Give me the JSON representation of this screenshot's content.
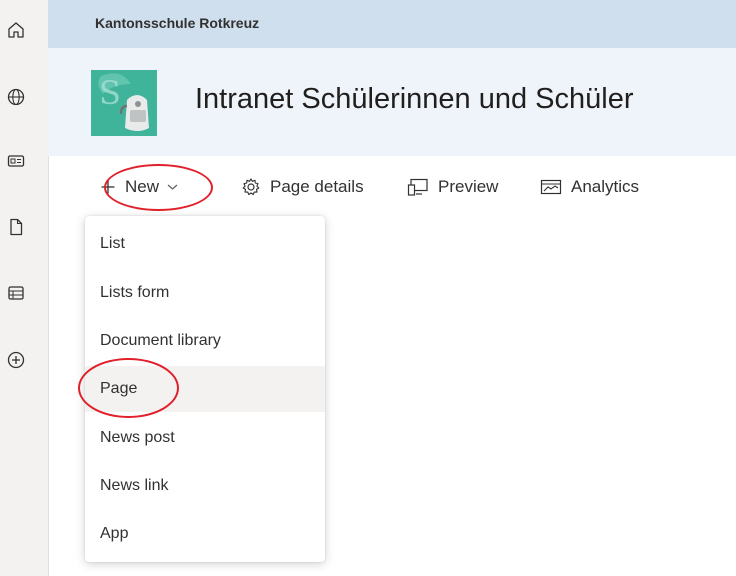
{
  "site": {
    "name": "Kantonsschule Rotkreuz"
  },
  "header": {
    "title": "Intranet Schülerinnen und Schüler"
  },
  "rail": {
    "icons": [
      "home-icon",
      "globe-icon",
      "news-card-icon",
      "document-icon",
      "list-icon",
      "add-circle-icon"
    ]
  },
  "commandbar": {
    "new_label": "New",
    "page_details_label": "Page details",
    "preview_label": "Preview",
    "analytics_label": "Analytics"
  },
  "new_menu": {
    "items": [
      "List",
      "Lists form",
      "Document library",
      "Page",
      "News post",
      "News link",
      "App"
    ],
    "highlighted_item": "Page"
  },
  "colors": {
    "topbar": "#cfdfee",
    "header": "#eef4fa",
    "annotation_red": "#e0202a",
    "logo_green": "#3fb49a"
  }
}
